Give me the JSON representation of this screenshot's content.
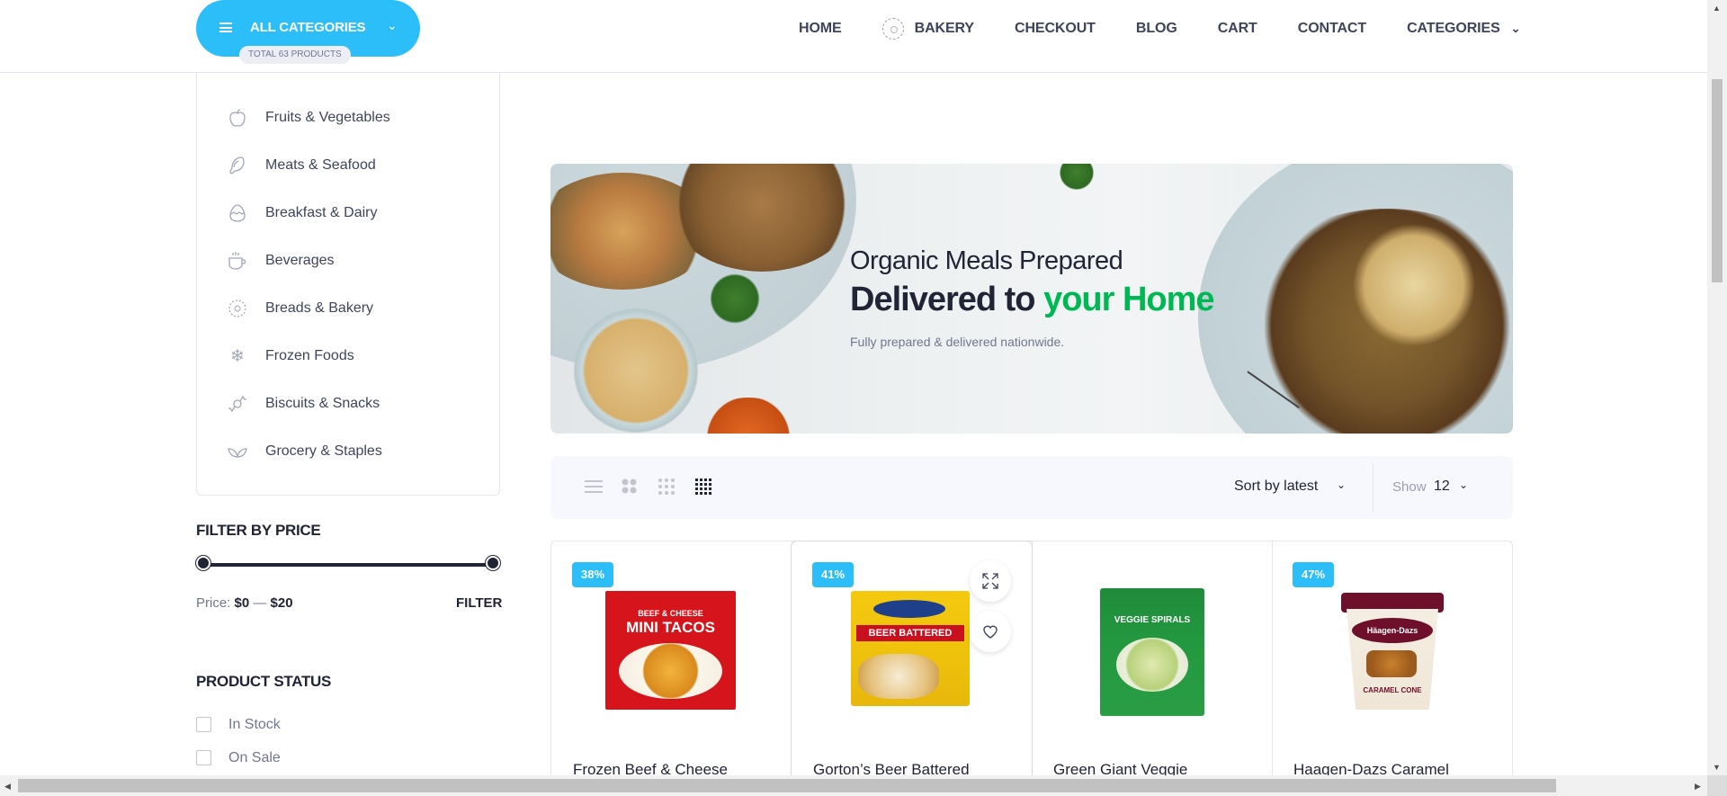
{
  "header": {
    "all_categories_label": "ALL CATEGORIES",
    "total_products": "TOTAL 63 PRODUCTS",
    "nav": [
      {
        "label": "HOME"
      },
      {
        "label": "BAKERY",
        "icon": "bread-icon"
      },
      {
        "label": "CHECKOUT"
      },
      {
        "label": "BLOG"
      },
      {
        "label": "CART"
      },
      {
        "label": "CONTACT"
      },
      {
        "label": "CATEGORIES",
        "icon": "chevron-down-icon"
      }
    ]
  },
  "sidebar": {
    "categories": [
      {
        "label": "Fruits & Vegetables",
        "icon": "apple-icon"
      },
      {
        "label": "Meats & Seafood",
        "icon": "drumstick-icon"
      },
      {
        "label": "Breakfast & Dairy",
        "icon": "egg-icon"
      },
      {
        "label": "Beverages",
        "icon": "cup-icon"
      },
      {
        "label": "Breads & Bakery",
        "icon": "bread-icon"
      },
      {
        "label": "Frozen Foods",
        "icon": "snowflake-icon"
      },
      {
        "label": "Biscuits & Snacks",
        "icon": "candy-icon"
      },
      {
        "label": "Grocery & Staples",
        "icon": "leaf-icon"
      }
    ],
    "filter_by_price": {
      "heading": "FILTER BY PRICE",
      "price_label": "Price:",
      "min": "$0",
      "separator": "—",
      "max": "$20",
      "button": "FILTER"
    },
    "product_status": {
      "heading": "PRODUCT STATUS",
      "options": [
        {
          "label": "In Stock",
          "checked": false
        },
        {
          "label": "On Sale",
          "checked": false
        }
      ]
    }
  },
  "banner": {
    "line1": "Organic Meals Prepared",
    "line2_start": "Delivered to ",
    "line2_highlight": "your Home",
    "line3": "Fully prepared & delivered nationwide."
  },
  "toolbar": {
    "view_modes": [
      "list-view-icon",
      "grid-2-icon",
      "grid-3-icon",
      "grid-4-icon"
    ],
    "active_view": "grid-4-icon",
    "sort_label": "Sort by latest",
    "show_label": "Show",
    "show_value": "12"
  },
  "products": [
    {
      "badge": "38%",
      "title": "Frozen Beef & Cheese",
      "image_text_top": "BEEF & CHEESE",
      "image_text_main": "MINI TACOS"
    },
    {
      "badge": "41%",
      "title": "Gorton’s Beer Battered",
      "image_text_main": "BEER BATTERED"
    },
    {
      "badge": "",
      "title": "Green Giant Veggie",
      "image_text_main": "VEGGIE SPIRALS"
    },
    {
      "badge": "47%",
      "title": "Haagen-Dazs Caramel",
      "image_text_brand": "Häagen-Dazs",
      "image_text_main": "CARAMEL CONE"
    }
  ],
  "colors": {
    "accent": "#2bbef9",
    "highlight_green": "#00b853",
    "text_dark": "#202435",
    "text_muted": "#71778e"
  }
}
